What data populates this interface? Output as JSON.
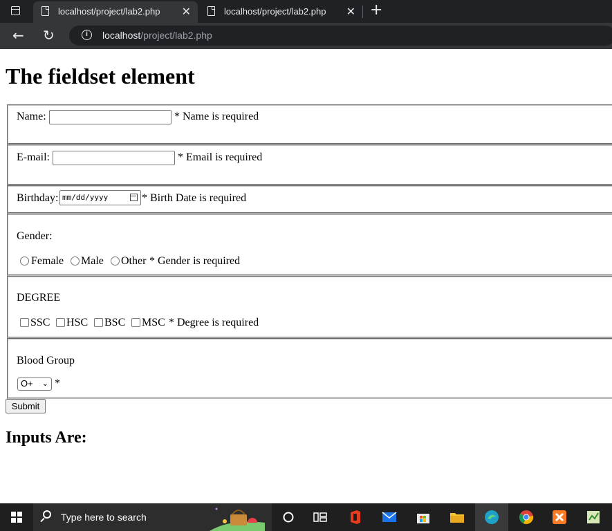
{
  "browser": {
    "tabs": [
      {
        "title": "localhost/project/lab2.php",
        "active": true
      },
      {
        "title": "localhost/project/lab2.php",
        "active": false
      }
    ],
    "close_glyph": "✕",
    "new_tab_glyph": "+",
    "back_glyph": "←",
    "reload_glyph": "↻",
    "info_glyph": "i",
    "address": {
      "host": "localhost",
      "path": "/project/lab2.php"
    }
  },
  "page": {
    "title": "The fieldset element",
    "name": {
      "label": "Name:",
      "value": "",
      "error": "* Name is required"
    },
    "email": {
      "label": "E-mail:",
      "value": "",
      "error": "* Email is required"
    },
    "birthday": {
      "label": "Birthday:",
      "placeholder": "mm/dd/yyyy",
      "error": "* Birth Date is required"
    },
    "gender": {
      "label": "Gender:",
      "options": [
        "Female",
        "Male",
        "Other"
      ],
      "error": "* Gender is required"
    },
    "degree": {
      "label": "DEGREE",
      "options": [
        "SSC",
        "HSC",
        "BSC",
        "MSC"
      ],
      "error": "* Degree is required"
    },
    "blood_group": {
      "label": "Blood Group",
      "selected": "O+",
      "required_mark": "*"
    },
    "submit_label": "Submit",
    "results_heading": "Inputs Are:"
  },
  "taskbar": {
    "search_placeholder": "Type here to search"
  }
}
